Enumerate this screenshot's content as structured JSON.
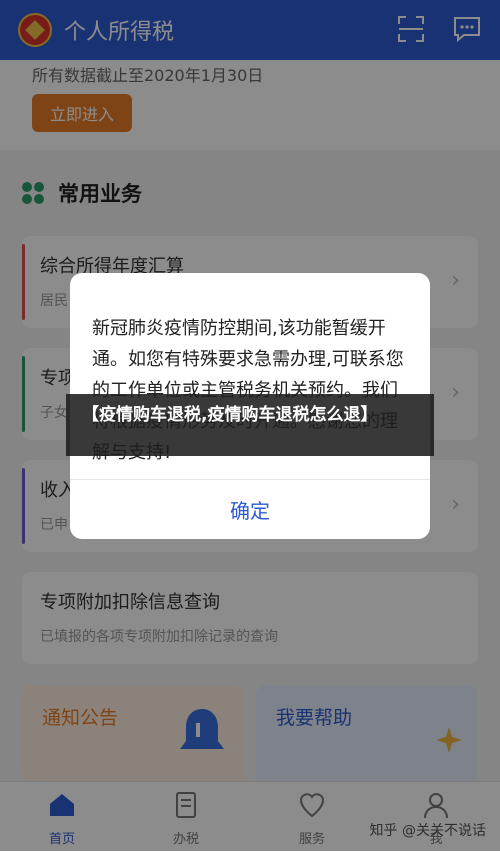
{
  "header": {
    "title": "个人所得税",
    "icons": [
      "scan-icon",
      "message-icon"
    ]
  },
  "banner": {
    "text": "所有数据截止至2020年1月30日",
    "button": "立即进入"
  },
  "section": {
    "title": "常用业务"
  },
  "cards": [
    {
      "title": "综合所得年度汇算",
      "sub": "居民",
      "accent": "#d9534f"
    },
    {
      "title": "专项",
      "sub": "子女",
      "accent": "#2f9b6c"
    },
    {
      "title": "收入",
      "sub": "已申",
      "accent": "#6a5acd"
    },
    {
      "title": "专项附加扣除信息查询",
      "sub": "已填报的各项专项附加扣除记录的查询",
      "accent": ""
    }
  ],
  "promos": [
    {
      "title": "通知公告",
      "color": "#e87d27"
    },
    {
      "title": "我要帮助",
      "color": "#2f5bd3"
    }
  ],
  "tabs": [
    {
      "label": "首页",
      "icon": "home-icon"
    },
    {
      "label": "办税",
      "icon": "document-icon"
    },
    {
      "label": "服务",
      "icon": "heart-hand-icon"
    },
    {
      "label": "我",
      "icon": "person-icon"
    }
  ],
  "watermark": "知乎 @关关不说话",
  "dialog": {
    "message": "新冠肺炎疫情防控期间,该功能暂缓开通。如您有特殊要求急需办理,可联系您的工作单位或主管税务机关预约。我们将根据疫情形势及时开通。感谢您的理解与支持!",
    "ok": "确定"
  },
  "caption": "【疫情购车退税,疫情购车退税怎么退】"
}
